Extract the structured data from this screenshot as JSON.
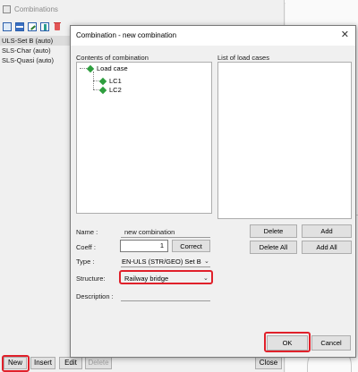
{
  "background_window": {
    "title": "Combinations",
    "list_items": [
      "ULS-Set B (auto)",
      "SLS-Char (auto)",
      "SLS-Quasi (auto)"
    ],
    "buttons": {
      "new": "New",
      "insert": "Insert",
      "edit": "Edit",
      "delete": "Delete",
      "close": "Close"
    }
  },
  "dialog": {
    "title": "Combination - new combination",
    "contents_label": "Contents of combination",
    "list_label": "List of load cases",
    "tree": {
      "root": "Load case",
      "children": [
        "LC1",
        "LC2"
      ]
    },
    "fields": {
      "name_label": "Name :",
      "name_value": "new combination",
      "coeff_label": "Coeff :",
      "coeff_value": "1",
      "correct_label": "Correct",
      "type_label": "Type :",
      "type_value": "EN-ULS (STR/GEO) Set B",
      "structure_label": "Structure:",
      "structure_value": "Railway bridge",
      "description_label": "Description :"
    },
    "buttons": {
      "delete": "Delete",
      "add": "Add",
      "delete_all": "Delete All",
      "add_all": "Add All",
      "ok": "OK",
      "cancel": "Cancel"
    }
  },
  "colors": {
    "highlight": "#e0202a",
    "tree_icon": "#2e9e3e",
    "toolbar_accent": "#2b5fab"
  }
}
